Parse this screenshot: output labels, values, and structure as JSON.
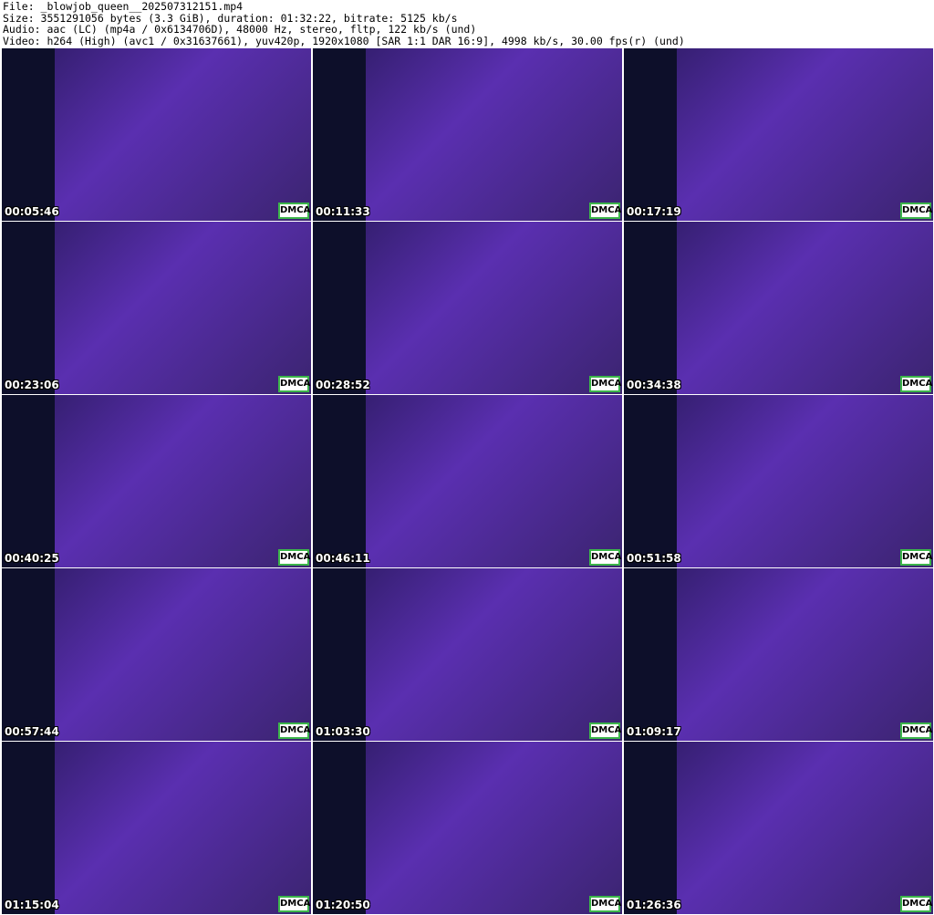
{
  "header": {
    "file": "File: _blowjob_queen__202507312151.mp4",
    "size": "Size: 3551291056 bytes (3.3 GiB), duration: 01:32:22, bitrate: 5125 kb/s",
    "audio": "Audio: aac (LC) (mp4a / 0x6134706D), 48000 Hz, stereo, fltp, 122 kb/s (und)",
    "video": "Video: h264 (High) (avc1 / 0x31637661), yuv420p, 1920x1080 [SAR 1:1 DAR 16:9], 4998 kb/s, 30.00 fps(r) (und)"
  },
  "badge": "DMCA",
  "thumbnails": [
    {
      "timestamp": "00:05:46"
    },
    {
      "timestamp": "00:11:33"
    },
    {
      "timestamp": "00:17:19"
    },
    {
      "timestamp": "00:23:06"
    },
    {
      "timestamp": "00:28:52"
    },
    {
      "timestamp": "00:34:38"
    },
    {
      "timestamp": "00:40:25"
    },
    {
      "timestamp": "00:46:11"
    },
    {
      "timestamp": "00:51:58"
    },
    {
      "timestamp": "00:57:44"
    },
    {
      "timestamp": "01:03:30"
    },
    {
      "timestamp": "01:09:17"
    },
    {
      "timestamp": "01:15:04"
    },
    {
      "timestamp": "01:20:50"
    },
    {
      "timestamp": "01:26:36"
    }
  ]
}
